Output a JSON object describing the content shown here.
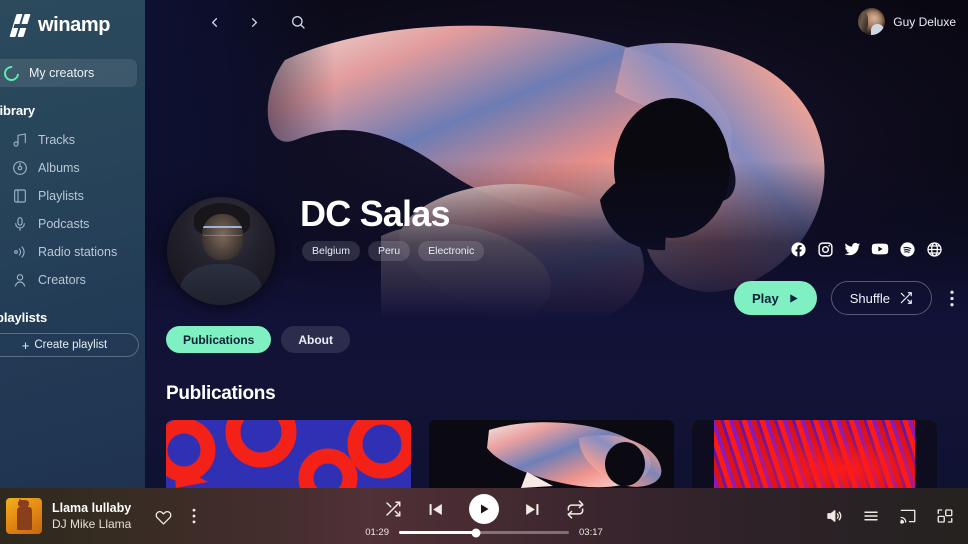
{
  "app": {
    "name": "winamp"
  },
  "sidebar": {
    "my_creators": {
      "label": "My creators",
      "icon": "creators-ring-icon"
    },
    "library_heading": "library",
    "library_items": [
      {
        "label": "Tracks",
        "icon": "music-note-icon"
      },
      {
        "label": "Albums",
        "icon": "disc-icon"
      },
      {
        "label": "Playlists",
        "icon": "playlist-icon"
      },
      {
        "label": "Podcasts",
        "icon": "podcast-mic-icon"
      },
      {
        "label": "Radio stations",
        "icon": "radio-waves-icon"
      },
      {
        "label": "Creators",
        "icon": "person-icon"
      }
    ],
    "playlists_heading": "playlists",
    "create_playlist": {
      "label": "Create playlist",
      "icon": "plus-icon"
    }
  },
  "topbar": {
    "back": "back-arrow",
    "forward": "forward-arrow",
    "search": "search-icon",
    "user": {
      "name": "Guy Deluxe",
      "avatar": "user-avatar"
    }
  },
  "artist": {
    "name": "DC Salas",
    "tags": [
      "Belgium",
      "Peru",
      "Electronic"
    ],
    "socials": [
      {
        "name": "facebook-icon"
      },
      {
        "name": "instagram-icon"
      },
      {
        "name": "twitter-icon"
      },
      {
        "name": "youtube-icon"
      },
      {
        "name": "spotify-icon"
      },
      {
        "name": "website-globe-icon"
      }
    ],
    "play_label": "Play",
    "shuffle_label": "Shuffle",
    "more_label": "more-options"
  },
  "content": {
    "tabs": [
      {
        "label": "Publications",
        "active": true
      },
      {
        "label": "About",
        "active": false
      }
    ],
    "section_title": "Publications",
    "cards": [
      {
        "art": "blue-red-rings"
      },
      {
        "art": "fabric-figure"
      },
      {
        "art": "red-purple-stripes"
      }
    ]
  },
  "player": {
    "track_title": "Llama lullaby",
    "track_artist": "DJ Mike Llama",
    "favorite_icon": "heart-icon",
    "more_icon": "kebab-menu-icon",
    "shuffle_icon": "shuffle-icon",
    "previous_icon": "previous-track-icon",
    "play_icon": "play-icon",
    "next_icon": "next-track-icon",
    "repeat_icon": "repeat-icon",
    "elapsed": "01:29",
    "duration": "03:17",
    "volume_icon": "volume-icon",
    "queue_icon": "queue-list-icon",
    "cast_icon": "cast-icon",
    "fullscreen_icon": "fullscreen-icon"
  },
  "colors": {
    "accent": "#7ff0c2",
    "sidebar_top": "#2c4a5c",
    "content_bg": "#121238"
  }
}
